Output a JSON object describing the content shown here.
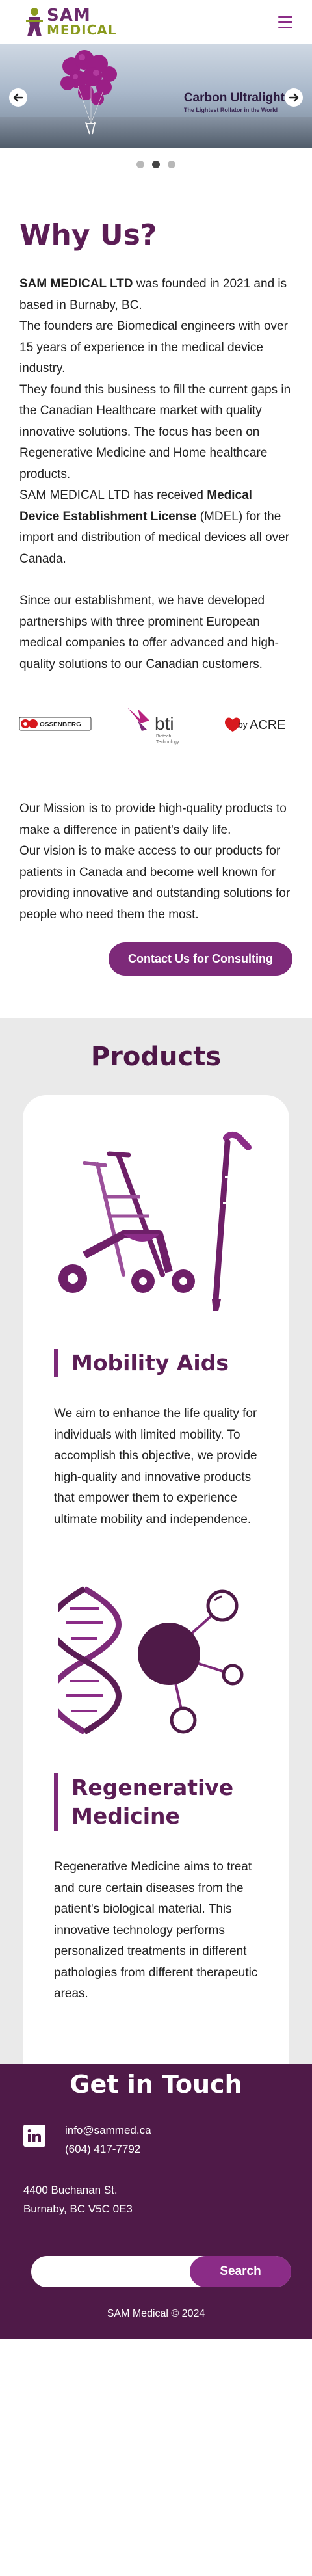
{
  "header": {
    "logo_line1": "SAM",
    "logo_line2": "MEDICAL",
    "menu_icon": "hamburger-menu-icon"
  },
  "carousel": {
    "slide_title": "Carbon Ultralight",
    "slide_subtitle": "The Lightest Rollator in the World",
    "prev_icon": "arrow-left-icon",
    "next_icon": "arrow-right-icon",
    "slides_count": 3,
    "active_slide": 2
  },
  "why_us": {
    "heading": "Why Us?",
    "p1_company": "SAM MEDICAL LTD",
    "p1_rest": " was founded in 2021 and is based in Burnaby, BC.",
    "p2": "The founders are Biomedical engineers with over 15 years of experience in the medical device industry.",
    "p3": "They found this business to fill the current gaps in the Canadian Healthcare market with quality innovative solutions. The focus has been on Regenerative Medicine and Home healthcare products.",
    "p4_start": "SAM MEDICAL LTD has received ",
    "p4_bold": "Medical Device Establishment License",
    "p4_end": " (MDEL) for the import and distribution of medical devices all over Canada.",
    "p5": "Since our establishment, we have developed partnerships with three prominent European medical companies to offer advanced and high-quality solutions to our Canadian customers.",
    "partners": [
      {
        "name": "OSSENBERG"
      },
      {
        "name": "bti",
        "tagline": "Biotech\nTechnology"
      },
      {
        "name": "byACRE",
        "prefix": "by",
        "word": "ACRE"
      }
    ],
    "mission": "Our Mission is to provide high-quality products to make a difference in patient's daily life.",
    "vision": "Our vision is to make access to our products for patients in Canada and become well known for providing innovative and outstanding solutions for people who need them the most.",
    "cta_label": "Contact Us for Consulting"
  },
  "products": {
    "heading": "Products",
    "items": [
      {
        "title": "Mobility Aids",
        "description": "We aim to enhance the life quality for individuals with limited mobility. To accomplish this objective, we provide high-quality and innovative products that empower them to experience ultimate mobility and independence.",
        "icon": "rollator-cane-icon"
      },
      {
        "title": "Regenerative Medicine",
        "description": "Regenerative Medicine aims to treat and cure certain diseases from the patient's biological material. This innovative technology performs personalized treatments in different pathologies from different therapeutic areas.",
        "icon": "dna-molecule-icon"
      }
    ]
  },
  "footer": {
    "heading": "Get in Touch",
    "email": "info@sammed.ca",
    "phone": "(604) 417-7792",
    "address_line1": "4400 Buchanan St.",
    "address_line2": "Burnaby, BC V5C 0E3",
    "search_placeholder": "",
    "search_label": "Search",
    "copyright": "SAM Medical © 2024",
    "social_icon": "linkedin-icon"
  },
  "colors": {
    "brand_purple": "#7d2a79",
    "heading_purple": "#5b1d55",
    "footer_bg": "#4f1a48",
    "brand_green": "#8a9a1e",
    "products_bg": "#eaeaea"
  }
}
